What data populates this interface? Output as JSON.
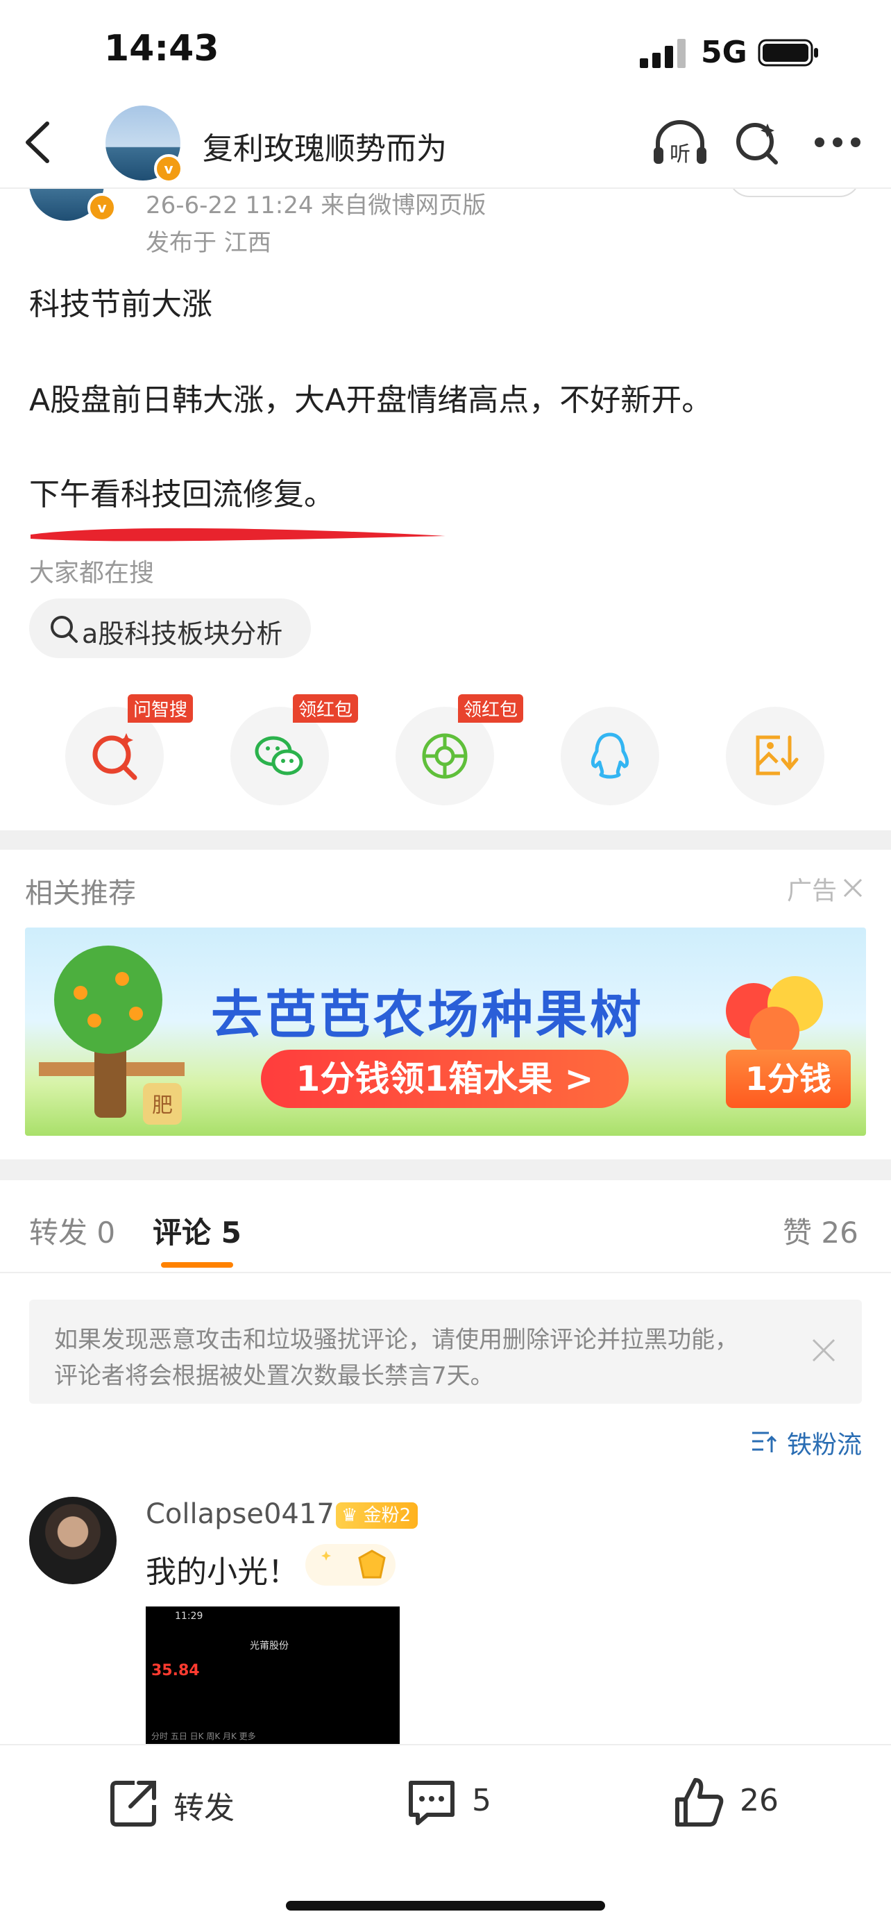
{
  "status": {
    "time": "14:43",
    "network": "5G"
  },
  "nav": {
    "title": "复利玫瑰顺势而为",
    "listen_icon": "listen-icon",
    "listen_text": "听"
  },
  "post": {
    "meta": "26-6-22 11:24  来自微博网页版",
    "location": "发布于 江西",
    "line1": "科技节前大涨",
    "line2": "A股盘前日韩大涨，大A开盘情绪高点，不好新开。",
    "line3": "下午看科技回流修复。"
  },
  "search": {
    "label": "大家都在搜",
    "query": "a股科技板块分析"
  },
  "share": [
    {
      "tag": "问智搜",
      "icon": "smart-search-icon"
    },
    {
      "tag": "领红包",
      "icon": "wechat-icon"
    },
    {
      "tag": "领红包",
      "icon": "moments-icon"
    },
    {
      "tag": "",
      "icon": "qq-icon"
    },
    {
      "tag": "",
      "icon": "save-image-icon"
    }
  ],
  "related": {
    "title": "相关推荐",
    "ad_label": "广告"
  },
  "banner": {
    "headline": "去芭芭农场种果树",
    "cta": "1分钱领1箱水果 >",
    "badge": "1分钱",
    "tree_label": "肥"
  },
  "tabs": {
    "repost": "转发",
    "repost_count": "0",
    "comment": "评论",
    "comment_count": "5",
    "like": "赞",
    "like_count": "26"
  },
  "notice": {
    "line1": "如果发现恶意攻击和垃圾骚扰评论，请使用删除评论并拉黑功能，",
    "line2": "评论者将会根据被处置次数最长禁言7天。"
  },
  "sort": {
    "label": "铁粉流"
  },
  "comment": {
    "user": "Collapse0417",
    "badge": "金粉2",
    "text": "我的小光！",
    "screenshot": {
      "time": "11:29",
      "stock": "光莆股份",
      "price": "35.84",
      "tabs": "分时  五日  日K  周K  月K  更多"
    }
  },
  "bottom": {
    "repost": "转发",
    "comments": "5",
    "likes": "26"
  },
  "colors": {
    "accent": "#ff8200",
    "link": "#2a6db3",
    "red": "#e8432d"
  }
}
